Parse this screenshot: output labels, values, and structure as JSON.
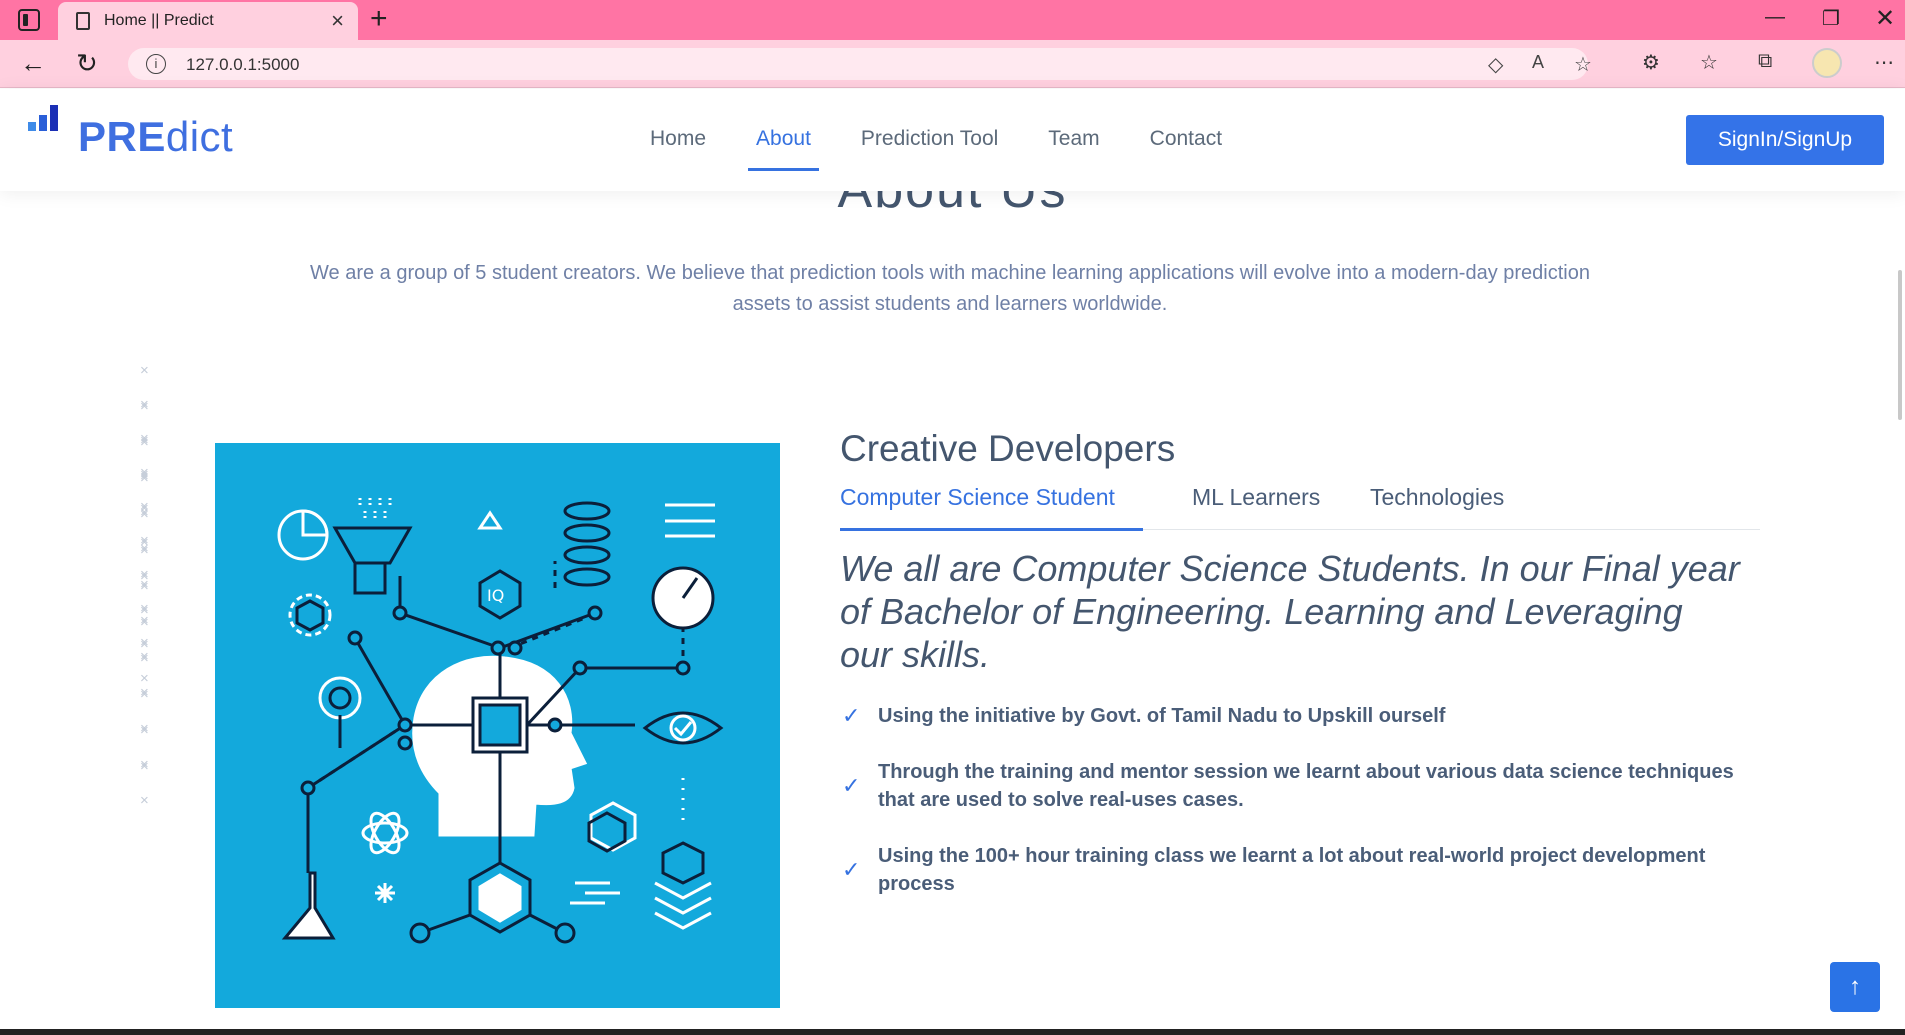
{
  "browser": {
    "tab_title": "Home || Predict",
    "url": "127.0.0.1:5000"
  },
  "header": {
    "logo_bold": "PRE",
    "logo_thin": "dict",
    "nav": [
      {
        "label": "Home",
        "active": false
      },
      {
        "label": "About",
        "active": true
      },
      {
        "label": "Prediction Tool",
        "active": false
      },
      {
        "label": "Team",
        "active": false
      },
      {
        "label": "Contact",
        "active": false
      }
    ],
    "signin_label": "SignIn/SignUp"
  },
  "about": {
    "title": "About Us",
    "description": "We are a group of 5 student creators. We believe that prediction tools with machine learning applications will evolve into a modern-day prediction assets to assist students and learners worldwide."
  },
  "creative": {
    "title": "Creative Developers",
    "tabs": [
      {
        "label": "Computer Science Student",
        "active": true
      },
      {
        "label": "ML Learners",
        "active": false
      },
      {
        "label": "Technologies",
        "active": false
      }
    ],
    "quote": "We all are Computer Science Students. In our Final year of Bachelor of Engineering. Learning and Leveraging our skills.",
    "points": [
      "Using the initiative by Govt. of Tamil Nadu to Upskill ourself",
      "Through the training and mentor session we learnt about various data science techniques that are used to solve real-uses cases.",
      "Using the 100+ hour training class we learnt a lot about real-world project development process"
    ]
  },
  "colors": {
    "browser_tab_bar": "#ff74a4",
    "accent": "#3672e0",
    "illustration_bg": "#13a9dc"
  },
  "icons": [
    "tab-actions-icon",
    "page-icon",
    "close-icon",
    "plus-icon",
    "minimize-icon",
    "restore-icon",
    "back-arrow-icon",
    "refresh-icon",
    "info-icon",
    "check-icon",
    "arrow-up-icon"
  ]
}
